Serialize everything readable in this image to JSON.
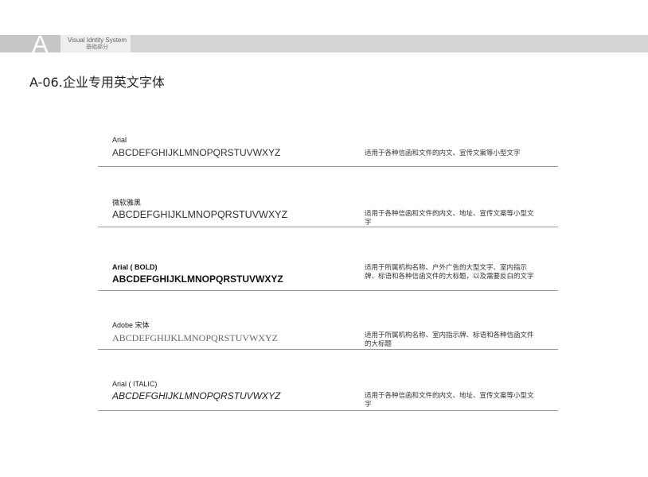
{
  "header": {
    "letter": "A",
    "system_title": "Visual Idntity System",
    "section": "基础部分"
  },
  "page_title": "A-06.企业专用英文字体",
  "fonts": [
    {
      "name": "Arial",
      "sample": "ABCDEFGHIJKLMNOPQRSTUVWXYZ",
      "usage": "适用于各种信函和文件的内文、宣传文案等小型文字"
    },
    {
      "name": "微软雅黑",
      "sample": "ABCDEFGHIJKLMNOPQRSTUVWXYZ",
      "usage": "适用于各种信函和文件的内文、地址、宣传文案等小型文字"
    },
    {
      "name": "Arial ( BOLD)",
      "sample": "ABCDEFGHIJKLMNOPQRSTUVWXYZ",
      "usage": "适用于所属机构名称、户外广告的大型文字、室内指示牌、标语和各种信函文件的大标题，以及需要反白的文字"
    },
    {
      "name": "Adobe 宋体",
      "sample": "ABCDEFGHIJKLMNOPQRSTUVWXYZ",
      "usage": "适用于所属机构名称、室内指示牌、标语和各种信函文件的大标题"
    },
    {
      "name": "Arial ( ITALIC)",
      "sample": "ABCDEFGHIJKLMNOPQRSTUVWXYZ",
      "usage": "适用于各种信函和文件的内文、地址、宣传文案等小型文字"
    }
  ]
}
